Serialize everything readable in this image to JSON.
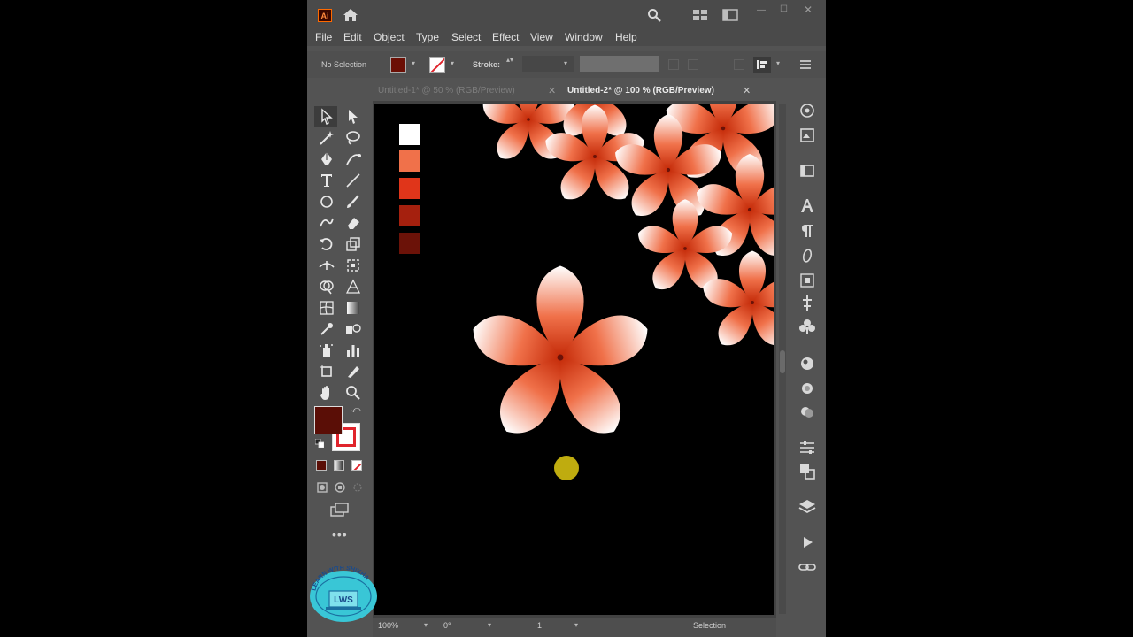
{
  "app": {
    "logo_text": "Ai",
    "icons": [
      "home-icon",
      "search-icon",
      "arrange-documents-icon",
      "panel-layout-icon",
      "minimize-icon",
      "maximize-icon",
      "close-icon"
    ],
    "window_controls": {
      "minimize": "—",
      "maximize": "☐",
      "close": "✕"
    }
  },
  "menu": [
    "File",
    "Edit",
    "Object",
    "Type",
    "Select",
    "Effect",
    "View",
    "Window",
    "Help"
  ],
  "control_bar": {
    "selection_label": "No Selection",
    "fill_color": "#6b0f05",
    "stroke_label": "Stroke:",
    "stroke_value": "",
    "caret": "▾",
    "spinner": "▴▾"
  },
  "tabs": [
    {
      "label": "Untitled-1* @ 50 % (RGB/Preview)",
      "close": "✕",
      "active": false
    },
    {
      "label": "Untitled-2* @ 100 % (RGB/Preview)",
      "close": "✕",
      "active": true
    }
  ],
  "toolbar": {
    "fill_color": "#5a0e06",
    "stroke_color": "#e0242c",
    "swap_glyph": "⤺",
    "more_glyph": "•••"
  },
  "canvas": {
    "background": "#000000",
    "swatches": [
      "#ffffff",
      "#f0714a",
      "#e0351a",
      "#a5200e",
      "#6b1208"
    ],
    "flower_gradient": [
      "#c42a08",
      "#ffffff"
    ],
    "cursor_color": "#c9b510"
  },
  "status_bar": {
    "zoom": "100%",
    "rotation": "0°",
    "artboard": "1",
    "tool": "Selection",
    "caret": "▾"
  },
  "watermark": {
    "text": "LEARN WITH SHIKHA",
    "badge": "LWS"
  }
}
